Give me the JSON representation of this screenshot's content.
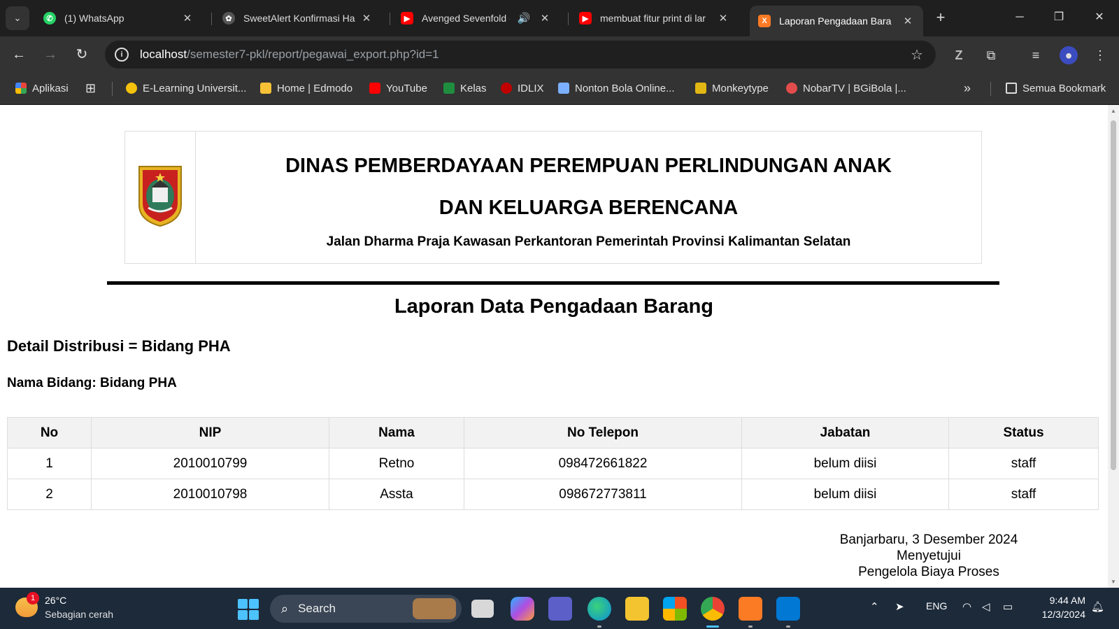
{
  "browser": {
    "tabs": [
      {
        "title": "(1) WhatsApp",
        "icon": "whatsapp-icon",
        "color": "#25d366",
        "active": false
      },
      {
        "title": "SweetAlert Konfirmasi Ha",
        "icon": "openai-icon",
        "color": "#444444",
        "active": false
      },
      {
        "title": "Avenged Sevenfold -",
        "icon": "youtube-icon",
        "color": "#ff0000",
        "active": false,
        "audio": "🔊"
      },
      {
        "title": "membuat fitur print di lar",
        "icon": "youtube-icon",
        "color": "#ff0000",
        "active": false
      },
      {
        "title": "Laporan Pengadaan Bara",
        "icon": "xampp-icon",
        "color": "#fb7a24",
        "active": true
      }
    ],
    "new_tab": "+",
    "close": "✕",
    "url_host": "localhost",
    "url_path": "/semester7-pkl/report/pegawai_export.php?id=1",
    "bookmarks": [
      {
        "label": "Aplikasi",
        "icon": "apps-grid-icon",
        "color": "#e8453c"
      },
      {
        "label": "E-Learning Universit...",
        "icon": "university-icon",
        "color": "#f4c20d"
      },
      {
        "label": "Home | Edmodo",
        "icon": "edmodo-icon",
        "color": "#f7c137"
      },
      {
        "label": "YouTube",
        "icon": "youtube-icon",
        "color": "#ff0000"
      },
      {
        "label": "Kelas",
        "icon": "classroom-icon",
        "color": "#1e8e3e"
      },
      {
        "label": "IDLIX",
        "icon": "idlix-icon",
        "color": "#c00000"
      },
      {
        "label": "Nonton Bola Online...",
        "icon": "nonton-bola-icon",
        "color": "#7bb0ff"
      },
      {
        "label": "Monkeytype",
        "icon": "monkeytype-icon",
        "color": "#e2b714"
      },
      {
        "label": "NobarTV | BGiBola |...",
        "icon": "nobartv-icon",
        "color": "#e34c4c"
      }
    ],
    "all_bookmarks": "Semua Bookmark"
  },
  "report": {
    "org_line1": "DINAS PEMBERDAYAAN PEREMPUAN PERLINDUNGAN ANAK",
    "org_line2": "DAN KELUARGA BERENCANA",
    "org_address": "Jalan Dharma Praja Kawasan Perkantoran Pemerintah Provinsi Kalimantan Selatan",
    "title": "Laporan Data Pengadaan Barang",
    "detail": "Detail Distribusi = Bidang PHA",
    "bidang": "Nama Bidang: Bidang PHA",
    "columns": [
      "No",
      "NIP",
      "Nama",
      "No Telepon",
      "Jabatan",
      "Status"
    ],
    "rows": [
      [
        "1",
        "2010010799",
        "Retno",
        "098472661822",
        "belum diisi",
        "staff"
      ],
      [
        "2",
        "2010010798",
        "Assta",
        "098672773811",
        "belum diisi",
        "staff"
      ]
    ],
    "sign_place_date": "Banjarbaru, 3 Desember 2024",
    "sign_approve": "Menyetujui",
    "sign_role": "Pengelola Biaya Proses"
  },
  "taskbar": {
    "weather_temp": "26°C",
    "weather_desc": "Sebagian cerah",
    "weather_badge": "1",
    "search": "Search",
    "lang": "ENG",
    "time": "9:44 AM",
    "date": "12/3/2024"
  }
}
